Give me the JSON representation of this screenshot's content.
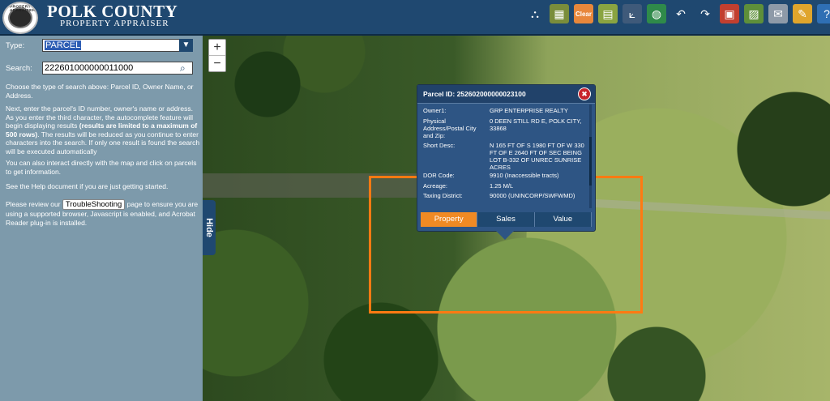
{
  "header": {
    "seal_text": "PROPERTY APPRAISER",
    "title": "POLK COUNTY",
    "subtitle": "PROPERTY APPRAISER",
    "toolbar": [
      {
        "name": "binoculars-icon",
        "glyph": "⛬",
        "color": "#1f4870"
      },
      {
        "name": "grid-icon",
        "glyph": "▦",
        "color": "#7a8d3b"
      },
      {
        "name": "clear-icon",
        "glyph": "Clear",
        "color": "#e8873b"
      },
      {
        "name": "map-layers-icon",
        "glyph": "▤",
        "color": "#8aa441"
      },
      {
        "name": "measure-icon",
        "glyph": "⟀",
        "color": "#3f5a7a"
      },
      {
        "name": "globe-icon",
        "glyph": "◍",
        "color": "#2f8a4a"
      },
      {
        "name": "undo-icon",
        "glyph": "↶",
        "color": "#1f4870"
      },
      {
        "name": "redo-icon",
        "glyph": "↷",
        "color": "#1f4870"
      },
      {
        "name": "print-map-icon",
        "glyph": "▣",
        "color": "#c23f2f"
      },
      {
        "name": "image-icon",
        "glyph": "▨",
        "color": "#5e8f3a"
      },
      {
        "name": "mail-icon",
        "glyph": "✉",
        "color": "#8e9aa8"
      },
      {
        "name": "notes-icon",
        "glyph": "✎",
        "color": "#e0a52c"
      },
      {
        "name": "help-icon",
        "glyph": "?",
        "color": "#2f6fb4"
      }
    ]
  },
  "search": {
    "type_label": "Type:",
    "type_value": "PARCEL",
    "search_label": "Search:",
    "search_value": "222601000000011000",
    "help1": "Choose the type of search above: Parcel ID, Owner Name, or Address.",
    "help2a": "Next, enter the parcel's ID number, owner's name or address. As you enter the third character, the autocomplete feature will begin displaying results ",
    "help2b": "(results are limited to a maximum of 500 rows)",
    "help2c": ". The results will be reduced as you continue to enter characters into the search. If only one result is found the search will be executed automatically",
    "help3": "You can also interact directly with the map and click on parcels to get information.",
    "help4": "See the Help document if you are just getting started.",
    "help5a": "Please review our ",
    "troubleshooting_label": "TroubleShooting",
    "help5b": " page to ensure you are using a supported browser, Javascript is enabled, and Acrobat Reader plug-in is installed."
  },
  "map": {
    "zoom_in": "+",
    "zoom_out": "−",
    "hide_label": "Hide"
  },
  "popup": {
    "title": "Parcel ID: 252602000000023100",
    "close": "✖",
    "fields": [
      {
        "key": "Owner1:",
        "value": "GRP ENTERPRISE REALTY"
      },
      {
        "key": "Physical Address/Postal City and Zip:",
        "value": "0 DEEN STILL RD E, POLK CITY, 33868"
      },
      {
        "key": "Short Desc:",
        "value": "N 165 FT OF S 1980 FT OF W 330 FT OF E 2640 FT OF SEC BEING LOT B-332 OF UNREC SUNRISE ACRES"
      },
      {
        "key": "DOR Code:",
        "value": "9910 (Inaccessible tracts)"
      },
      {
        "key": "Acreage:",
        "value": "1.25 M/L"
      },
      {
        "key": "Taxing District:",
        "value": "90000 (UNINCORP/SWFWMD)"
      }
    ],
    "tabs": [
      "Property",
      "Sales",
      "Value"
    ]
  }
}
